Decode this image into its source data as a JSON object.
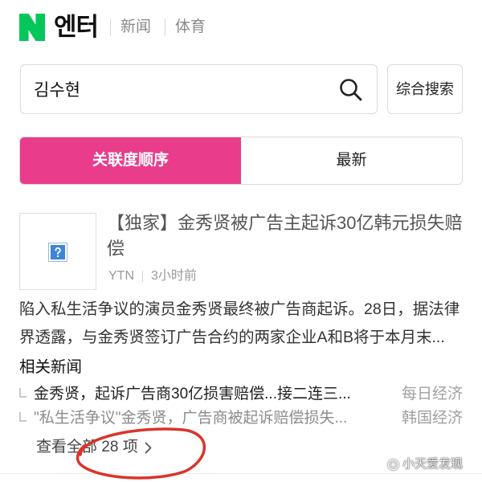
{
  "header": {
    "logo_text": "N",
    "logo_icon": "naver-n-logo-icon",
    "title": "엔터",
    "nav": [
      "新闻",
      "体育"
    ]
  },
  "search": {
    "query": "김수현",
    "icon": "search-icon",
    "button_label": "综合搜索"
  },
  "sort_tabs": [
    {
      "label": "关联度顺序",
      "active": true
    },
    {
      "label": "最新",
      "active": false
    }
  ],
  "article": {
    "thumbnail_icon": "broken-image-icon",
    "title": "【独家】金秀贤被广告主起诉30亿韩元损失赔偿",
    "source": "YTN",
    "time": "3小时前",
    "summary": "陷入私生活争议的演员金秀贤最终被广告商起诉。28日，据法律界透露，与金秀贤签订广告合约的两家企业A和B将于本月末..."
  },
  "related": {
    "heading": "相关新闻",
    "bullet_icon": "reply-corner-icon",
    "items": [
      {
        "title": "金秀贤，起诉广告商30亿损害赔偿...接二连三...",
        "source": "每日经济"
      },
      {
        "title": "\"私生活争议\"金秀贤，广告商被起诉赔偿损失...",
        "source": "韩国经济"
      }
    ],
    "view_all": "查看全部 28 项",
    "view_all_icon": "chevron-right-icon"
  },
  "watermark": {
    "icon": "watermark-logo-icon",
    "text": "小天爱发现"
  },
  "colors": {
    "brand": "#03c75a",
    "active_tab": "#e93d8c",
    "annotation": "#d9352b"
  }
}
